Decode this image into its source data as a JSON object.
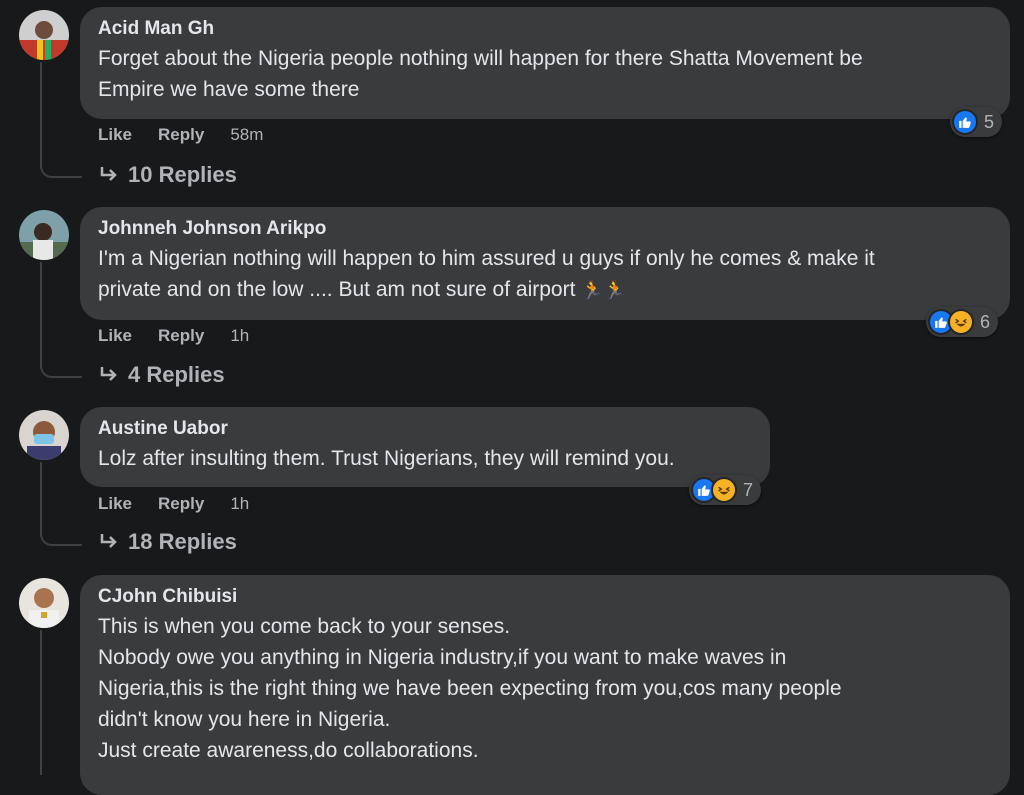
{
  "actions": {
    "like": "Like",
    "reply": "Reply"
  },
  "comments": [
    {
      "author": "Acid Man Gh",
      "text": "Forget about the Nigeria people nothing will happen for there Shatta Movement be\nEmpire we have some there",
      "time": "58m",
      "reaction_count": "5",
      "reactions": [
        "like-icon"
      ],
      "replies": "10 Replies"
    },
    {
      "author": "Johnneh Johnson Arikpo",
      "text": "I'm a Nigerian nothing will happen to him assured u guys if only he comes & make it\nprivate and on the low .... But am not sure of airport",
      "time": "1h",
      "reaction_count": "6",
      "reactions": [
        "like-icon",
        "haha-icon"
      ],
      "replies": "4 Replies"
    },
    {
      "author": "Austine Uabor",
      "text": "Lolz after insulting them. Trust Nigerians, they will remind you.",
      "time": "1h",
      "reaction_count": "7",
      "reactions": [
        "like-icon",
        "haha-icon"
      ],
      "replies": "18 Replies"
    },
    {
      "author": "CJohn Chibuisi",
      "text": "This is when you come back to your senses.\nNobody owe you anything in Nigeria industry,if you want to make waves in\nNigeria,this is the right thing we have been expecting from you,cos many people\ndidn't know you here in Nigeria.\nJust create awareness,do collaborations."
    }
  ]
}
